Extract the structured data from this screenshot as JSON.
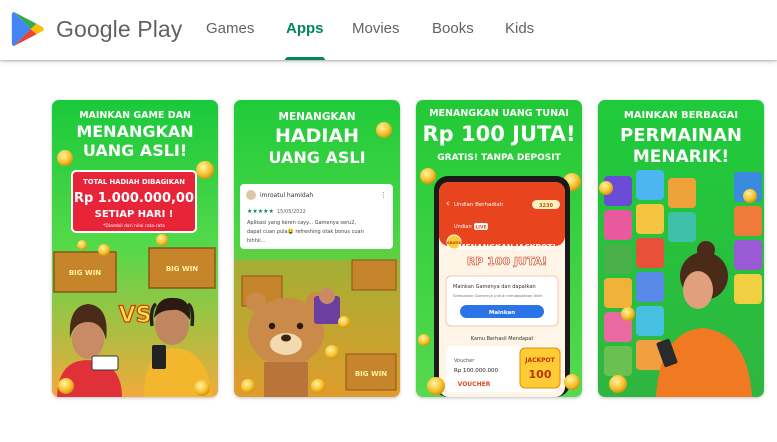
{
  "brand": {
    "name": "Google Play",
    "icon": "google-play-logo",
    "colors": {
      "blue": "#4285f4",
      "green": "#34a853",
      "yellow": "#fbbc04",
      "red": "#ea4335"
    }
  },
  "nav": {
    "accent": "#01875f",
    "items": [
      {
        "label": "Games",
        "active": false
      },
      {
        "label": "Apps",
        "active": true
      },
      {
        "label": "Movies",
        "active": false
      },
      {
        "label": "Books",
        "active": false
      },
      {
        "label": "Kids",
        "active": false
      }
    ]
  },
  "screenshots": [
    {
      "headline": [
        "MAINKAN GAME DAN",
        "MENANGKAN",
        "UANG ASLI!"
      ],
      "banner": {
        "title": "TOTAL HADIAH DIBAGIKAN",
        "amount": "Rp 1.000.000,00",
        "subtitle": "SETIAP HARI !",
        "note": "*Diambil dari nilai rata-rata"
      },
      "badge": "VS",
      "chest_labels": [
        "BIG WIN",
        "BIG WIN"
      ]
    },
    {
      "headline": [
        "MENANGKAN",
        "HADIAH",
        "UANG ASLI"
      ],
      "review": {
        "user": "imroatul hamidah",
        "stars": "★★★★★",
        "date": "15/05/2022",
        "text": [
          "Aplikasi yang keren cayy... Gamenya seru2,",
          "dapat cuan pula🤑 refreshing otak bonus cuan",
          "hihhii..."
        ],
        "menu": "⋮"
      },
      "chest_label": "BIG WIN"
    },
    {
      "headline": [
        "MENANGKAN UANG TUNAI",
        "Rp 100 JUTA!",
        "GRATIS! TANPA DEPOSIT"
      ],
      "phone": {
        "back": "‹",
        "screen_title": "Undian Berhadiah",
        "coins": "3230",
        "tab": "Undian",
        "live": "LIVE",
        "gratis": "GRATIS",
        "jackpot": [
          "MENANGKAN JACKPOT!",
          "RP 100 JUTA!"
        ],
        "task": "Mainkan Gamenya dan dapatkan",
        "task_sub": "Selesaikan Gamenya untuk mendapatkan tiket",
        "play_button": "Mainkan",
        "winners_title": "Kamu Berhasil Mendapat",
        "voucher_label": "Voucher",
        "voucher_value": "Rp 100.000.000",
        "voucher_stamp": "VOUCHER",
        "jackpot_tag": [
          "JACKPOT",
          "100"
        ]
      }
    },
    {
      "headline": [
        "MAINKAN BERBAGAI",
        "PERMAINAN",
        "MENARIK!"
      ]
    }
  ]
}
